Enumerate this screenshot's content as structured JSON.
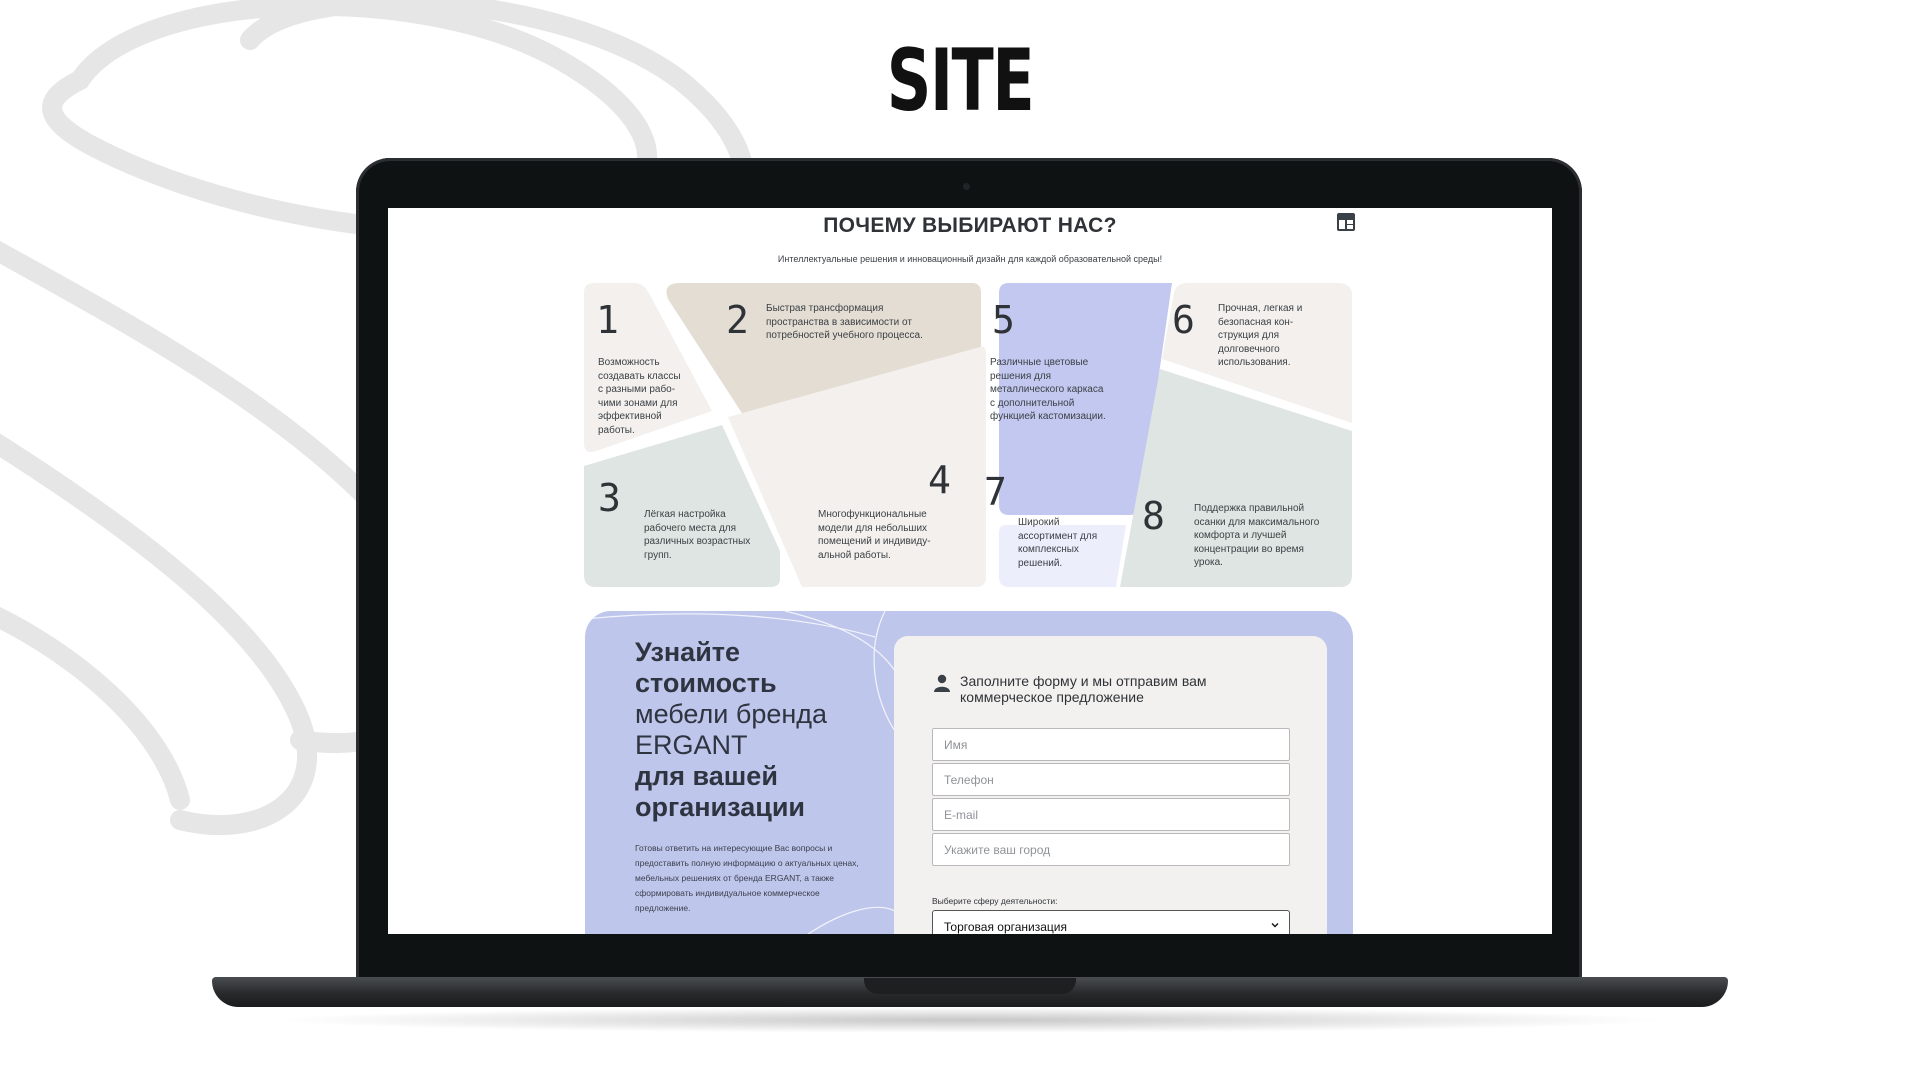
{
  "headline": "SITE",
  "site": {
    "title": "ПОЧЕМУ ВЫБИРАЮТ НАС?",
    "subtitle": "Интеллектуальные решения и инновационный дизайн для каждой образовательной среды!",
    "logo_icon": "layout-grid-icon"
  },
  "features": [
    {
      "number": "1",
      "text": [
        "Возможность",
        "создавать классы",
        "с разными рабо-",
        "чими зонами для",
        "эффективной",
        "работы."
      ],
      "color": "#f3f0ed"
    },
    {
      "number": "2",
      "text": [
        "Быстрая трансформация",
        "пространства в зависимости от",
        "потребностей учебного процесса."
      ],
      "color": "#e3ddd3"
    },
    {
      "number": "3",
      "text": [
        "Лёгкая настройка",
        "рабочего места для",
        "различных возрастных",
        "групп."
      ],
      "color": "#dfe5e2"
    },
    {
      "number": "4",
      "text": [
        "Многофункциональные",
        "модели для небольших",
        "помещений и индивиду-",
        "альной работы."
      ],
      "color": "#f3f0ed"
    },
    {
      "number": "5",
      "text": [
        "Различные цветовые",
        "решения для",
        "металлического каркаса",
        "с дополнительной",
        "функцией кастомизации."
      ],
      "color": "#c2c8ef"
    },
    {
      "number": "6",
      "text": [
        "Прочная, легкая и",
        "безопасная кон-",
        "струкция для",
        "долговечного",
        "использования."
      ],
      "color": "#f3f0ed"
    },
    {
      "number": "7",
      "text": [
        "Широкий",
        "ассортимент для",
        "комплексных",
        "решений."
      ],
      "color": "#eceefb"
    },
    {
      "number": "8",
      "text": [
        "Поддержка правильной",
        "осанки для максимального",
        "комфорта и лучшей",
        "концентрации во время",
        "урока."
      ],
      "color": "#dfe5e2"
    }
  ],
  "cta": {
    "heading_bold_1": "Узнайте",
    "heading_bold_2": "стоимость",
    "heading_light_1": "мебели бренда",
    "heading_light_2": "ERGANT",
    "heading_bold_3": "для вашей",
    "heading_bold_4": "организации",
    "description": "Готовы ответить на интересующие Вас вопросы и предоставить полную информацию о актуальных ценах, мебельных решениях от бренда ERGANT, а также сформировать индивидуальное коммерческое предложение."
  },
  "form": {
    "icon": "user-icon",
    "heading": "Заполните форму и мы отправим вам коммерческое предложение",
    "name_placeholder": "Имя",
    "phone_placeholder": "Телефон",
    "email_placeholder": "E-mail",
    "city_placeholder": "Укажите ваш город",
    "select_label": "Выберите сферу деятельности:",
    "select_value": "Торговая организация"
  }
}
